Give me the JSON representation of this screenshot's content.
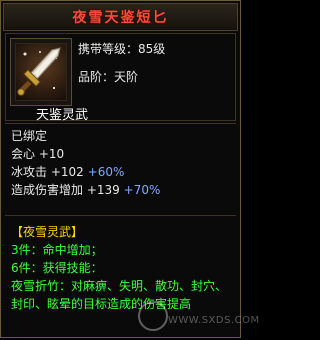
{
  "item": {
    "name": "夜雪天鉴短匕",
    "carry_level": "携带等级：85级",
    "grade": "品阶：天阶",
    "subtype": "天鉴灵武",
    "icon": "dagger-icon"
  },
  "stats": {
    "bound": "已绑定",
    "crit": "会心 +10",
    "ice_attack": {
      "label": "冰攻击",
      "base": "+102",
      "bonus": "+60%"
    },
    "damage_bonus": {
      "label": "造成伤害增加",
      "base": "+139",
      "bonus": "+70%"
    }
  },
  "set": {
    "name": "【夜雪灵武】",
    "p3": {
      "count": "3件：",
      "effect": "命中增加；"
    },
    "p6": {
      "count": "6件：",
      "effect": "获得技能："
    },
    "skill": "夜雪折竹：对麻痹、失明、散功、封穴、封印、眩晕的目标造成的伤害提高"
  },
  "watermark": {
    "text": "WWW.SXDS.COM"
  },
  "colors": {
    "title": "#ff4a3a",
    "green": "#3cff3c",
    "blue": "#7fa8ff",
    "set_head": "#ffd400",
    "border": "#6b5a3a"
  }
}
